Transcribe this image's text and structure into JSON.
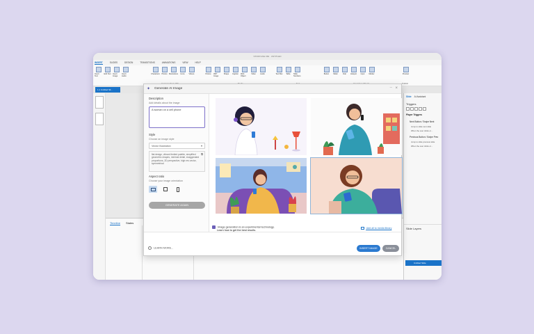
{
  "app": {
    "window_title": "STORYLINE 360 · UNTITLED",
    "ribbon_tabs": [
      "INSERT",
      "SLIDES",
      "DESIGN",
      "TRANSITIONS",
      "ANIMATIONS",
      "VIEW",
      "HELP"
    ],
    "ribbon_buttons": [
      "Insert Text",
      "Edit Text",
      "Insert Image",
      "Insert Audio",
      "Characters",
      "Photos",
      "Illustrations",
      "Icons",
      "Videos",
      "Picture",
      "360° Image",
      "Shape",
      "Caption",
      "Web Object",
      "Video",
      "Audio",
      "Text Box",
      "Table",
      "Slide Numbers",
      "Button",
      "Slider",
      "Dial",
      "Hotspot",
      "Input",
      "Marker",
      "Preview"
    ],
    "ribbon_groups": [
      "Content Library 360",
      "Media",
      "Text",
      "Interactive Objects",
      "Publish"
    ],
    "document_tab": "1.1 Untitled Sli...",
    "timeline_tabs": [
      "Timeline",
      "States"
    ],
    "right_panel": {
      "tabs": [
        "Slide",
        "AI Assistant"
      ],
      "triggers_title": "Triggers",
      "player_triggers_title": "Player Triggers",
      "triggers": [
        {
          "name": "Next Button / Swipe Next",
          "desc1": "Jump to slide next slide",
          "desc2": "When the user clicks or..."
        },
        {
          "name": "Previous Button / Swipe Prev",
          "desc1": "Jump to slide previous slide",
          "desc2": "When the user clicks or..."
        }
      ],
      "slide_layers_title": "Slide Layers",
      "selected_layer": "Untitled Slide"
    }
  },
  "dialog": {
    "title": "Generate AI Image",
    "description_label": "Description",
    "description_hint": "Add details about the image",
    "description_value": "A woman on a cell phone",
    "style_label": "Style",
    "style_hint": "Choose an image style",
    "style_value": "Vector Illustration",
    "style_text": "flat design, vibrant limited palette, simplified geometric shapes, minimal detail, exaggerated proportions, 2D perspective, high res vector, symmetrical",
    "aspect_label": "Aspect ratio",
    "aspect_hint": "Choose your image orientation",
    "generate_button": "GENERATE AGAIN",
    "notice_line1": "Image generation is an experimental technology.",
    "notice_line2": "Learn how to get the best results.",
    "add_to_library": "Add all to media library",
    "learn_more": "LEARN MORE...",
    "insert_button": "INSERT IMAGE",
    "cancel_button": "CANCEL"
  },
  "colors": {
    "background": "#dcd7ef",
    "accent_blue": "#2b7ad0",
    "input_border": "#7d70c9",
    "generate_button": "#a6a6a6",
    "cancel_button": "#8a8f99"
  },
  "icons": [
    "ai-sparkle-icon",
    "close-icon",
    "chevron-down-icon",
    "copy-icon",
    "landscape-icon",
    "square-icon",
    "portrait-icon",
    "info-icon",
    "library-icon",
    "help-icon",
    "cursor-icon"
  ]
}
